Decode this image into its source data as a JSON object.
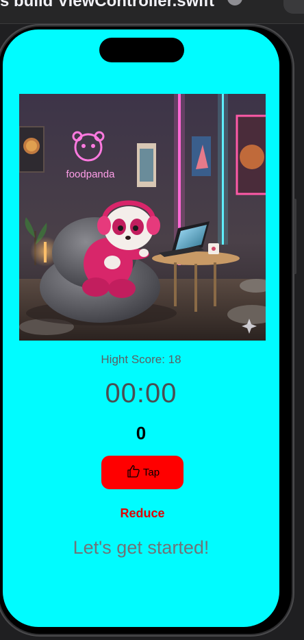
{
  "host_window": {
    "title": "ts build ViewController.swift"
  },
  "screen": {
    "background_color": "#00fcff",
    "hero_image": {
      "neon_sign_text": "foodpanda",
      "description_icon": "panda-gaming-illustration"
    },
    "high_score_label": "Hight Score: 18",
    "timer": "00:00",
    "tap_count": "0",
    "tap_button": {
      "icon": "thumbs-up-icon",
      "label": "Tap",
      "color": "#ff0000"
    },
    "reduce_button": {
      "label": "Reduce",
      "color": "#e20000"
    },
    "status_message": "Let's get started!"
  }
}
